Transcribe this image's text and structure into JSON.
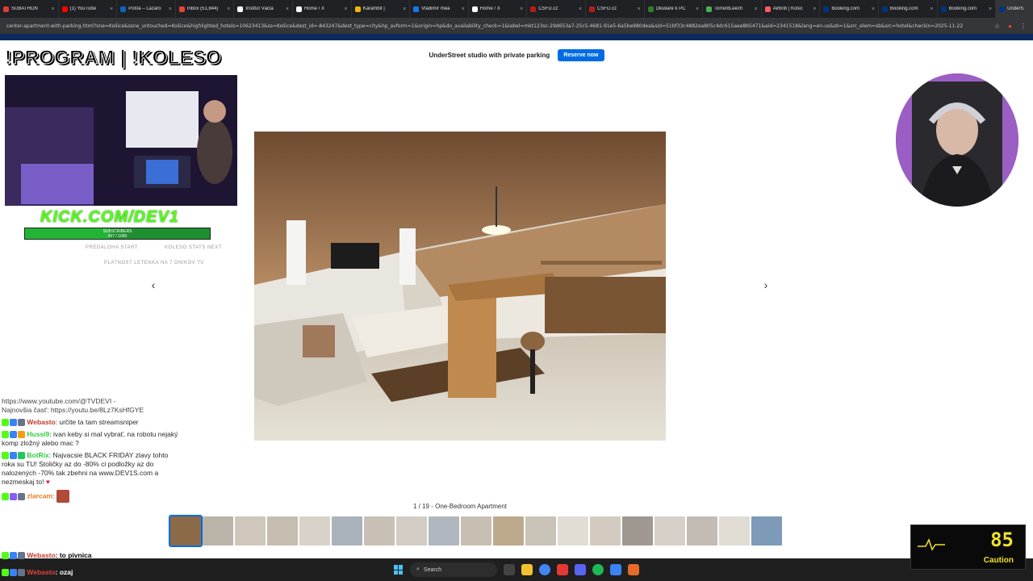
{
  "browser": {
    "tabs": [
      {
        "label": "SUBATHON",
        "color": "#e53935"
      },
      {
        "label": "(1) YouTube",
        "color": "#ff0000"
      },
      {
        "label": "Pošta – Lazaro",
        "color": "#0a66c2"
      },
      {
        "label": "Inbox (51,844)",
        "color": "#ea4335"
      },
      {
        "label": "Institut Václa",
        "color": "#ffffff"
      },
      {
        "label": "Home / X",
        "color": "#ffffff"
      },
      {
        "label": "Karambit |",
        "color": "#f2b705"
      },
      {
        "label": "Vladimír mea",
        "color": "#1877f2"
      },
      {
        "label": "Home / X",
        "color": "#ffffff"
      },
      {
        "label": "ČSFD.cz",
        "color": "#b71c1c"
      },
      {
        "label": "ČSFD.cz",
        "color": "#b71c1c"
      },
      {
        "label": "Okuliare k PC",
        "color": "#2e7d32"
      },
      {
        "label": "TorrentLeech",
        "color": "#4caf50"
      },
      {
        "label": "Airbnb | Košic",
        "color": "#ff5a5f"
      },
      {
        "label": "Booking.com",
        "color": "#003580"
      },
      {
        "label": "Booking.com",
        "color": "#003580"
      },
      {
        "label": "Booking.com",
        "color": "#003580"
      },
      {
        "label": "UnderS",
        "color": "#003580"
      }
    ],
    "url": "center-apartment-with-parking.html?sne=Košice&ssne_untouched=Košice&highlighted_hotels=10623413&ss=Košice&dest_id=-843247&dest_type=city&hp_avform=1&origin=hp&do_availability_check=1&label=mkt123sc-29d653a7-25c5-4681-91e5-6a5be980dea&sid=51bf33c4882ea805c4dc615aee8b5471&aid=2341518&lang=en-us&sb=1&src_elem=sb&src=hotel&checkin=2025-11-22"
  },
  "booking": {
    "property_title": "UnderStreet studio with private parking",
    "reserve_label": "Reserve now",
    "prev_arrow": "‹",
    "next_arrow": "›",
    "caption": "1 / 19 - One-Bedroom Apartment",
    "thumb_colors": [
      "#8b6a48",
      "#b9b3a8",
      "#cfc7bb",
      "#c4bdb0",
      "#d8d2c8",
      "#aab2bb",
      "#c8c0b4",
      "#d2ccc4",
      "#b0b7be",
      "#c7bfb2",
      "#bda98c",
      "#c9c2b7",
      "#e1ddd5",
      "#d3cbbf",
      "#9e9890",
      "#d6d0c8",
      "#c2bcb4",
      "#e0dcd4",
      "#7d9ab8"
    ]
  },
  "stream": {
    "title": "!PROGRAM | !KOLESO",
    "kick_brand": "KICK.COM/DEV1",
    "sub_label": "SUBSCRIBERS",
    "sub_count": "457 / 1000",
    "sub_progress": 0.457,
    "faint_1": "PREDALOHA START",
    "faint_2": "KOLESO STATS NEXT",
    "faint_3": "PLATNOST LETENKA NA 7 DNIKOV TV"
  },
  "chat": {
    "link_1": "https://www.youtube.com/@TVDEVI -",
    "link_2": "Najnovšia časť: https://youtu.be/8Lz7KsHfGYE",
    "messages": [
      {
        "user": "Webasto",
        "user_color": "#c0392b",
        "text": ": určite ta tam streamsniper"
      },
      {
        "user": "Hussi9",
        "user_color": "#2ecc40",
        "text": ": ivan keby si mal vybrať, na robotu nejaký komp zložný alebo mac ?"
      },
      {
        "user": "BotRix",
        "user_color": "#2ecc40",
        "text": ": Najvacsie BLACK FRIDAY zlavy tohto roka su TU! Stoličky az do -80% ci podložky az do nalozených -70% tak zbehni na www.DEV1S.com a nezmeskaj to!"
      },
      {
        "user": "zlarcam",
        "user_color": "#e67e22",
        "text": ":"
      },
      {
        "user": "Webasto",
        "user_color": "#c0392b",
        "text": ": to pivnica"
      },
      {
        "user": "Webasto",
        "user_color": "#c0392b",
        "text": ": ozaj"
      }
    ],
    "heart": "♥"
  },
  "taskbar": {
    "search_label": "Search"
  },
  "temp_widget": {
    "value": "85",
    "status": "Caution"
  }
}
